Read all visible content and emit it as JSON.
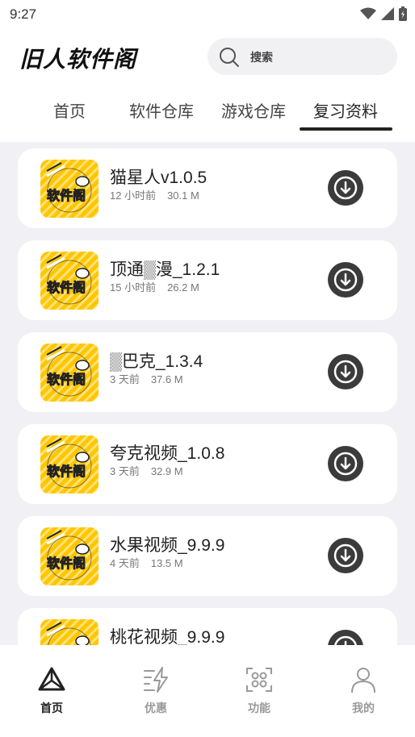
{
  "status_bar": {
    "time": "9:27"
  },
  "header": {
    "logo_text": "旧人软件阁",
    "search_placeholder": "搜索"
  },
  "tabs": [
    {
      "label": "首页"
    },
    {
      "label": "软件仓库"
    },
    {
      "label": "游戏仓库"
    },
    {
      "label": "复习资料",
      "active": true
    }
  ],
  "apps": [
    {
      "name": "猫星人v1.0.5",
      "time": "12 小时前",
      "size": "30.1 M"
    },
    {
      "name": "顶通▒漫_1.2.1",
      "time": "15 小时前",
      "size": "26.2 M"
    },
    {
      "name": "▒巴克_1.3.4",
      "time": "3 天前",
      "size": "37.6 M"
    },
    {
      "name": "夸克视频_1.0.8",
      "time": "3 天前",
      "size": "32.9 M"
    },
    {
      "name": "水果视频_9.9.9",
      "time": "4 天前",
      "size": "13.5 M"
    },
    {
      "name": "桃花视频_9.9.9",
      "time": "",
      "size": ""
    }
  ],
  "app_icon_text": "软件阁",
  "bottom_nav": [
    {
      "label": "首页",
      "icon": "home-triangle-icon",
      "active": true
    },
    {
      "label": "优惠",
      "icon": "bolt-icon"
    },
    {
      "label": "功能",
      "icon": "grid-icon"
    },
    {
      "label": "我的",
      "icon": "user-icon"
    }
  ],
  "colors": {
    "accent": "#ffc600",
    "dark": "#3b3b3b",
    "content_bg": "#f1f0f4"
  }
}
